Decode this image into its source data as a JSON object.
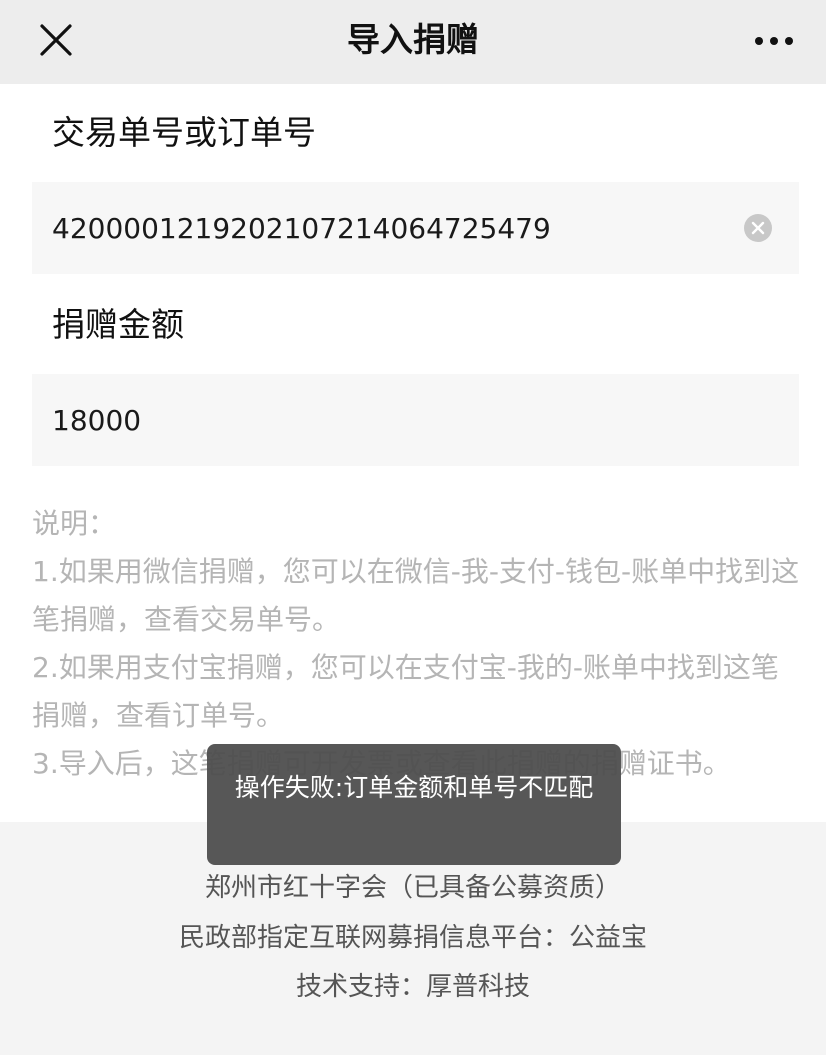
{
  "header": {
    "title": "导入捐赠",
    "close_icon": "close-icon",
    "more_icon": "more-icon"
  },
  "form": {
    "order_label": "交易单号或订单号",
    "order_value": "4200001219202107214064725479",
    "amount_label": "捐赠金额",
    "amount_value": "18000",
    "clear_icon": "clear-circle-icon"
  },
  "notes": {
    "title": "说明：",
    "line1": "1.如果用微信捐赠，您可以在微信-我-支付-钱包-账单中找到这笔捐赠，查看交易单号。",
    "line2": "2.如果用支付宝捐赠，您可以在支付宝-我的-账单中找到这笔捐赠，查看订单号。",
    "line3": "3.导入后，这笔捐赠可开发票或查看此捐赠的捐赠证书。"
  },
  "footer": {
    "org": "郑州市红十字会（已具备公募资质）",
    "platform": "民政部指定互联网募捐信息平台：公益宝",
    "support": "技术支持：厚普科技"
  },
  "toast": {
    "message": "操作失败:订单金额和单号不匹配"
  },
  "colors": {
    "navbar_bg": "#ededed",
    "input_bg": "#f7f7f7",
    "notes_text": "#b5b5b5",
    "footer_bg": "#f4f4f4",
    "toast_bg": "#4c4c4c"
  }
}
